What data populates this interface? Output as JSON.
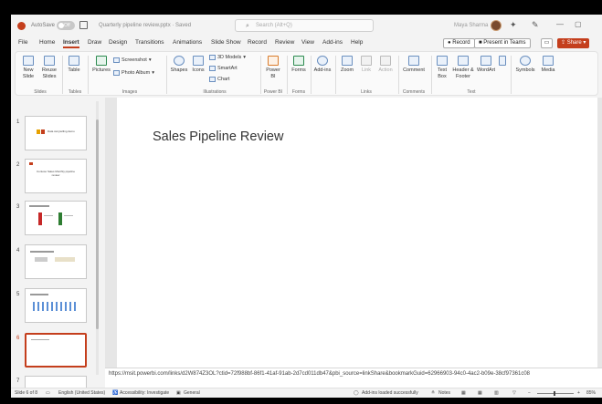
{
  "title_bar": {
    "autosave_label": "AutoSave",
    "autosave_state": "Off",
    "document_title": "Quarterly pipeline review.pptx · Saved",
    "search_placeholder": "Search (Alt+Q)",
    "user_name": "Maya Sharma"
  },
  "menu_tabs": [
    "File",
    "Home",
    "Insert",
    "Draw",
    "Design",
    "Transitions",
    "Animations",
    "Slide Show",
    "Record",
    "Review",
    "View",
    "Add-ins",
    "Help"
  ],
  "active_tab": "Insert",
  "actions": {
    "record_label": "Record",
    "present_label": "Present in Teams",
    "share_label": "Share"
  },
  "ribbon": {
    "slides": {
      "new_slide": "New Slide",
      "reuse_slides": "Reuse Slides",
      "group_label": "Slides"
    },
    "tables": {
      "table": "Table",
      "group_label": "Tables"
    },
    "images": {
      "pictures": "Pictures",
      "screenshot": "Screenshot",
      "photo_album": "Photo Album",
      "group_label": "Images"
    },
    "illustrations": {
      "shapes": "Shapes",
      "icons": "Icons",
      "models_3d": "3D Models",
      "smartart": "SmartArt",
      "chart": "Chart",
      "group_label": "Illustrations"
    },
    "power_bi": {
      "label": "Power BI",
      "group_label": "Power BI"
    },
    "forms": {
      "label": "Forms",
      "group_label": "Forms"
    },
    "addins": {
      "label": "Add-ins"
    },
    "links": {
      "zoom": "Zoom",
      "link": "Link",
      "action": "Action",
      "group_label": "Links"
    },
    "comments": {
      "comment": "Comment",
      "group_label": "Comments"
    },
    "text": {
      "text_box": "Text Box",
      "header_footer": "Header & Footer",
      "wordart": "WordArt",
      "group_label": "Text"
    },
    "symbols": {
      "label": "Symbols"
    },
    "media": {
      "label": "Media"
    }
  },
  "thumbnails": [
    {
      "number": "1",
      "caption": "Data storytelling demo"
    },
    {
      "number": "2",
      "caption": "Contoso Sales Monthly pipeline review"
    },
    {
      "number": "3",
      "caption": ""
    },
    {
      "number": "4",
      "caption": ""
    },
    {
      "number": "5",
      "caption": ""
    },
    {
      "number": "6",
      "caption": ""
    },
    {
      "number": "7",
      "caption": ""
    }
  ],
  "selected_slide": "6",
  "slide": {
    "title": "Sales Pipeline Review"
  },
  "notes": {
    "text": "https://msit.powerbi.com/links/d2W874Z3OL?ctid=72f988bf-86f1-41af-91ab-2d7cd011db47&pbi_source=linkShare&bookmarkGuid=62966903-94c0-4ac2-b09e-38cf97361c08"
  },
  "status_bar": {
    "slide_counter": "Slide 6 of 8",
    "language": "English (United States)",
    "accessibility": "Accessibility: Investigate",
    "sensitivity": "General",
    "addins_status": "Add-ins loaded successfully",
    "notes_label": "Notes",
    "zoom_level": "85%"
  },
  "colors": {
    "accent": "#c43e1c",
    "ribbon_bg": "#fafafa",
    "app_bg": "#f3f3f3"
  }
}
